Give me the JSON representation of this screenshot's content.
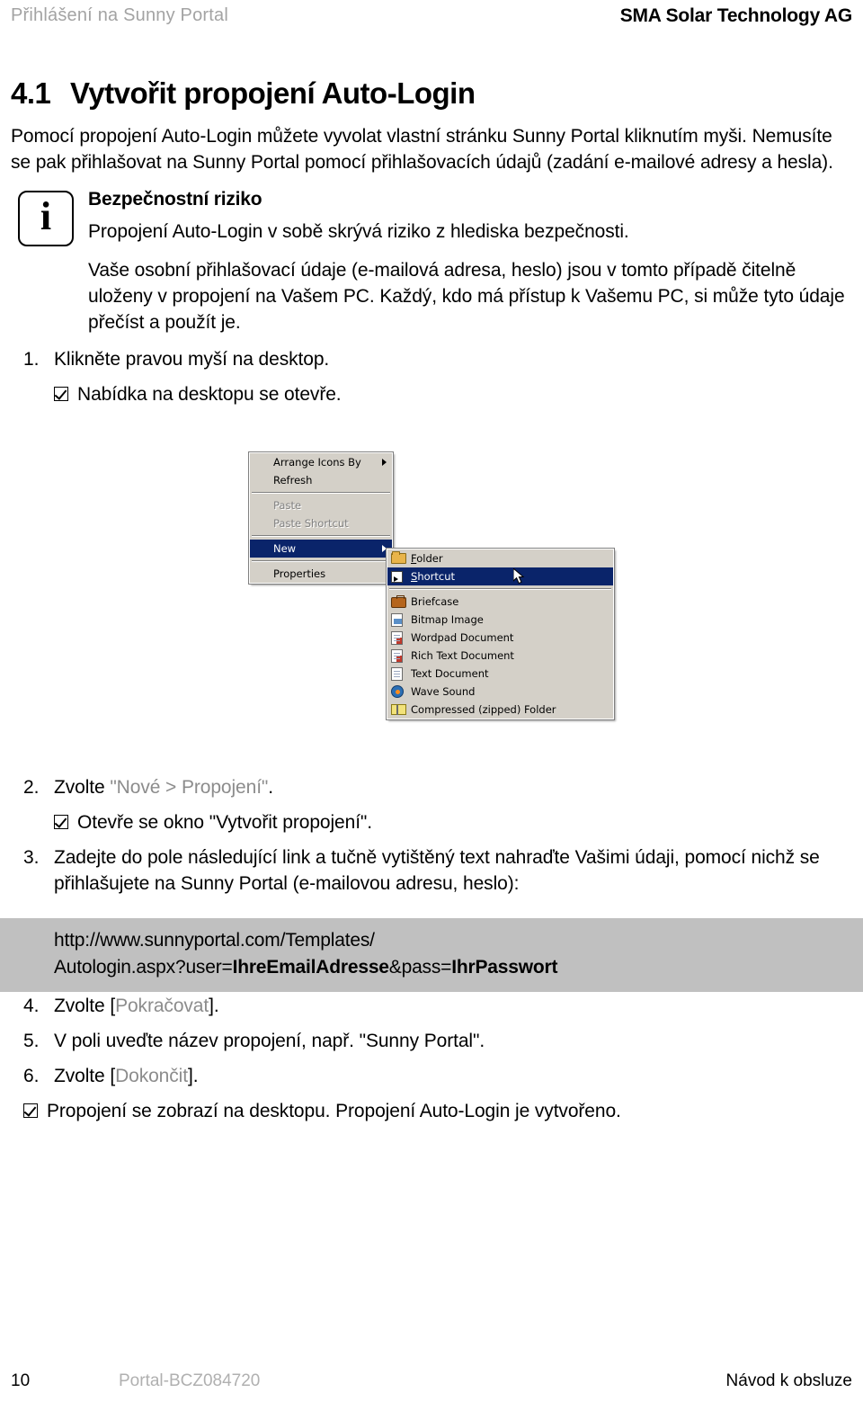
{
  "header": {
    "left": "Přihlášení na Sunny Portal",
    "right": "SMA Solar Technology AG"
  },
  "section": {
    "number": "4.1",
    "title": "Vytvořit propojení Auto-Login",
    "intro": "Pomocí propojení Auto-Login můžete vyvolat vlastní stránku Sunny Portal kliknutím myši. Nemusíte se pak přihlašovat na Sunny Portal pomocí přihlašovacích údajů (zadání e-mailové adresy a hesla)."
  },
  "note": {
    "icon": "info-icon",
    "icon_glyph": "i",
    "title": "Bezpečnostní riziko",
    "paragraph1": "Propojení Auto-Login v sobě skrývá riziko z hlediska bezpečnosti.",
    "paragraph2": "Vaše osobní přihlašovací údaje (e-mailová adresa, heslo) jsou v tomto případě čitelně uloženy v propojení na Vašem PC. Každý, kdo má přístup k Vašemu PC, si může tyto údaje přečíst a použít je."
  },
  "steps": {
    "s1": {
      "num": "1.",
      "text": "Klikněte pravou myší na desktop."
    },
    "s1_result": "Nabídka na desktopu se otevře.",
    "s2": {
      "num": "2.",
      "prefix": "Zvolte ",
      "quoted": "\"Nové > Propojení\"",
      "suffix": "."
    },
    "s2_result": "Otevře se okno \"Vytvořit propojení\".",
    "s3": {
      "num": "3.",
      "text": "Zadejte do pole následující link a tučně vytištěný text nahraďte Vašimi údaji, pomocí nichž se přihlašujete na Sunny Portal (e-mailovou adresu, heslo):"
    },
    "s4": {
      "num": "4.",
      "prefix": "Zvolte [",
      "grey": "Pokračovat",
      "suffix": "]."
    },
    "s5": {
      "num": "5.",
      "text": "V poli uveďte název propojení, např. \"Sunny Portal\"."
    },
    "s6": {
      "num": "6.",
      "prefix": "Zvolte [",
      "grey": "Dokončit",
      "suffix": "]."
    },
    "final_result": "Propojení se zobrazí na desktopu. Propojení Auto-Login je vytvořeno."
  },
  "url_box": {
    "background": "#c0c0c0",
    "line1": "http://www.sunnyportal.com/Templates/",
    "line2_a": "Autologin.aspx?user=",
    "line2_b": "IhreEmailAdresse",
    "line2_c": "&pass=",
    "line2_d": "IhrPasswort"
  },
  "screenshot": {
    "caption": "windows-desktop-context-menu",
    "highlight_color": "#0a246a",
    "menu_background": "#d4d0c8",
    "context_menu": [
      {
        "label": "Arrange Icons By",
        "state": "normal",
        "submenu": true
      },
      {
        "label": "Refresh",
        "state": "normal",
        "submenu": false
      },
      {
        "separator": true
      },
      {
        "label": "Paste",
        "state": "disabled",
        "submenu": false
      },
      {
        "label": "Paste Shortcut",
        "state": "disabled",
        "submenu": false
      },
      {
        "separator": true
      },
      {
        "label": "New",
        "state": "selected",
        "submenu": true
      },
      {
        "separator": true
      },
      {
        "label": "Properties",
        "state": "normal",
        "submenu": false
      }
    ],
    "submenu": [
      {
        "label": "Folder",
        "icon": "folder-icon",
        "state": "normal"
      },
      {
        "label": "Shortcut",
        "icon": "shortcut-icon",
        "state": "selected"
      },
      {
        "separator": true
      },
      {
        "label": "Briefcase",
        "icon": "briefcase-icon",
        "state": "normal"
      },
      {
        "label": "Bitmap Image",
        "icon": "bitmap-image-icon",
        "state": "normal"
      },
      {
        "label": "Wordpad Document",
        "icon": "wordpad-document-icon",
        "state": "normal"
      },
      {
        "label": "Rich Text Document",
        "icon": "rich-text-document-icon",
        "state": "normal"
      },
      {
        "label": "Text Document",
        "icon": "text-document-icon",
        "state": "normal"
      },
      {
        "label": "Wave Sound",
        "icon": "wave-sound-icon",
        "state": "normal"
      },
      {
        "label": "Compressed (zipped) Folder",
        "icon": "zipped-folder-icon",
        "state": "normal"
      }
    ]
  },
  "footer": {
    "page": "10",
    "code": "Portal-BCZ084720",
    "right": "Návod k obsluze"
  }
}
